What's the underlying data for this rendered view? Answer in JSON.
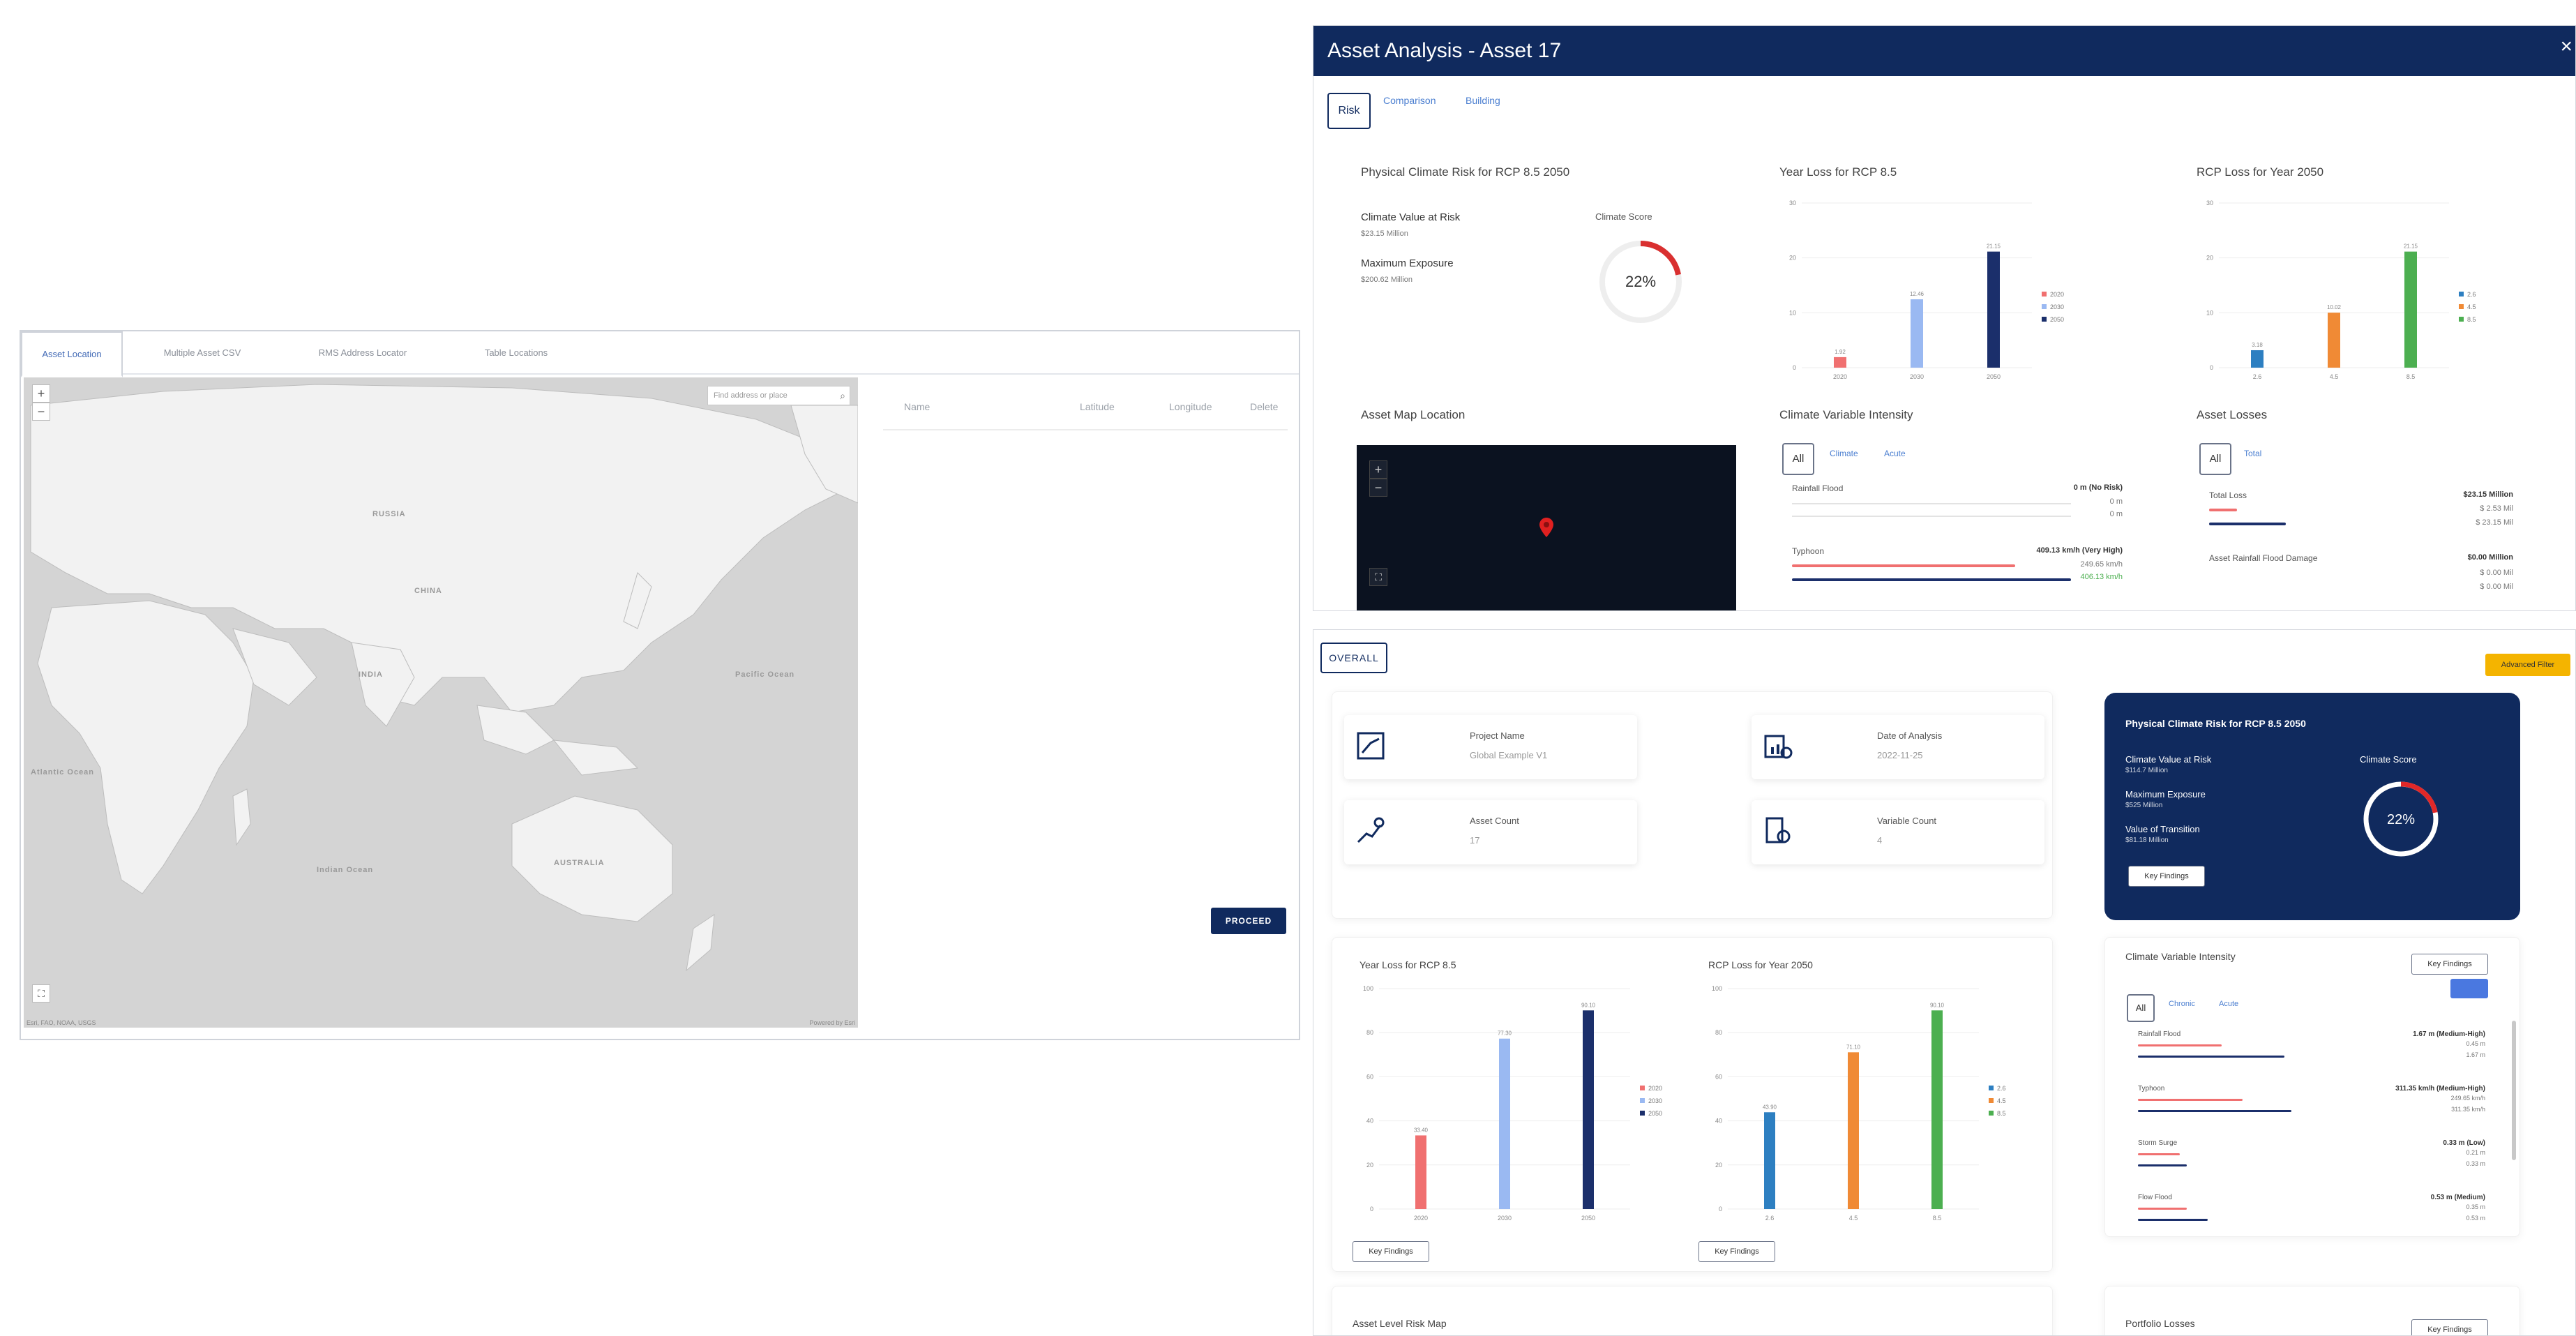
{
  "asset_location": {
    "tabs": [
      "Asset Location",
      "Multiple Asset CSV",
      "RMS Address Locator",
      "Table Locations"
    ],
    "map": {
      "search_placeholder": "Find address or place",
      "zoom_in": "+",
      "zoom_out": "−",
      "fullscreen": "⛶",
      "attribution_left": "Esri, FAO, NOAA, USGS",
      "attribution_right": "Powered by Esri",
      "labels": [
        "RUSSIA",
        "CHINA",
        "INDIA",
        "AUSTRALIA",
        "Pacific Ocean",
        "Indian Ocean",
        "Atlantic Ocean"
      ]
    },
    "table_headers": [
      "Name",
      "Latitude",
      "Longitude",
      "Delete"
    ],
    "proceed_label": "PROCEED"
  },
  "asset_analysis": {
    "title": "Asset Analysis - Asset 17",
    "close_label": "×",
    "tabs": {
      "active": "Risk",
      "others": [
        "Comparison",
        "Building"
      ]
    },
    "physical_risk": {
      "title": "Physical Climate Risk for RCP 8.5 2050",
      "cvar_label": "Climate Value at Risk",
      "cvar_value": "$23.15 Million",
      "max_exposure_label": "Maximum Exposure",
      "max_exposure_value": "$200.62 Million",
      "score_label": "Climate Score",
      "score_value": "22%",
      "score_fraction": 0.22
    },
    "year_loss_title": "Year Loss for RCP 8.5",
    "rcp_loss_title": "RCP Loss for Year 2050",
    "asset_map_title": "Asset Map Location",
    "climate_intensity": {
      "title": "Climate Variable Intensity",
      "all": "All",
      "links": [
        "Climate",
        "Acute"
      ],
      "rows": [
        {
          "label": "Rainfall Flood",
          "value": "0 m (No Risk)",
          "sub1": "0 m",
          "sub2": "0 m"
        },
        {
          "label": "Typhoon",
          "value": "409.13 km/h (Very High)",
          "sub1": "249.65 km/h",
          "sub2": "406.13 km/h"
        }
      ]
    },
    "asset_losses": {
      "title": "Asset Losses",
      "all": "All",
      "links": [
        "Total"
      ],
      "rows": [
        {
          "label": "Total Loss",
          "value": "$23.15 Million",
          "sub1": "$ 2.53 Mil",
          "sub2": "$ 23.15 Mil"
        },
        {
          "label": "Asset Rainfall Flood Damage",
          "value": "$0.00 Million",
          "sub1": "$ 0.00 Mil",
          "sub2": "$ 0.00 Mil"
        }
      ]
    }
  },
  "overall": {
    "tab_label": "OVERALL",
    "filter_label": "Advanced Filter",
    "cards": [
      {
        "label": "Project Name",
        "value": "Global Example V1"
      },
      {
        "label": "Date of Analysis",
        "value": "2022-11-25"
      },
      {
        "label": "Asset Count",
        "value": "17"
      },
      {
        "label": "Variable Count",
        "value": "4"
      }
    ],
    "risk_card": {
      "title": "Physical Climate Risk for RCP 8.5 2050",
      "cvar_label": "Climate Value at Risk",
      "cvar_value": "$114.7 Million",
      "max_exposure_label": "Maximum Exposure",
      "max_exposure_value": "$525 Million",
      "vot_label": "Value of Transition",
      "vot_value": "$81.18 Million",
      "score_label": "Climate Score",
      "score_value": "22%",
      "score_fraction": 0.22,
      "key_findings": "Key Findings"
    },
    "year_loss_title": "Year Loss for RCP 8.5",
    "rcp_loss_title": "RCP Loss for Year 2050",
    "key_findings": "Key Findings",
    "climate_intensity": {
      "title": "Climate Variable Intensity",
      "key_findings": "Key Findings",
      "all": "All",
      "links": [
        "Chronic",
        "Acute"
      ],
      "rows": [
        {
          "label": "Rainfall Flood",
          "value": "1.67 m (Medium-High)",
          "sub1": "0.45 m",
          "sub2": "1.67 m"
        },
        {
          "label": "Typhoon",
          "value": "311.35 km/h (Medium-High)",
          "sub1": "249.65 km/h",
          "sub2": "311.35 km/h"
        },
        {
          "label": "Storm Surge",
          "value": "0.33 m (Low)",
          "sub1": "0.21 m",
          "sub2": "0.33 m"
        },
        {
          "label": "Flow Flood",
          "value": "0.53 m (Medium)",
          "sub1": "0.35 m",
          "sub2": "0.53 m"
        }
      ]
    },
    "asset_risk_map_title": "Asset Level Risk Map",
    "portfolio_losses_title": "Portfolio Losses",
    "portfolio_key_findings": "Key Findings"
  },
  "colors": {
    "navy": "#102a5e",
    "red": "#f07070",
    "light_blue": "#9ab9f2",
    "dark_navy": "#1b2f6b",
    "blue": "#2d7fc1",
    "orange": "#f08a35",
    "green": "#4caf50",
    "amber": "#f4b400"
  },
  "chart_data": [
    {
      "id": "aa_year_loss",
      "type": "bar",
      "title": "Year Loss for RCP 8.5",
      "categories": [
        "2020",
        "2030",
        "2050"
      ],
      "values": [
        1.92,
        12.46,
        21.15
      ],
      "data_labels": [
        "1.92",
        "12.46",
        "21.15"
      ],
      "legend": [
        "2020",
        "2030",
        "2050"
      ],
      "ylim": [
        0,
        30
      ],
      "yticks": [
        0,
        10,
        20,
        30
      ]
    },
    {
      "id": "aa_rcp_loss",
      "type": "bar",
      "title": "RCP Loss for Year 2050",
      "categories": [
        "2.6",
        "4.5",
        "8.5"
      ],
      "values": [
        3.18,
        10.02,
        21.15
      ],
      "data_labels": [
        "3.18",
        "10.02",
        "21.15"
      ],
      "legend": [
        "2.6",
        "4.5",
        "8.5"
      ],
      "ylim": [
        0,
        30
      ],
      "yticks": [
        0,
        10,
        20,
        30
      ]
    },
    {
      "id": "ov_year_loss",
      "type": "bar",
      "title": "Year Loss for RCP 8.5",
      "categories": [
        "2020",
        "2030",
        "2050"
      ],
      "values": [
        33.4,
        77.3,
        90.1
      ],
      "data_labels": [
        "33.40",
        "77.30",
        "90.10"
      ],
      "legend": [
        "2020",
        "2030",
        "2050"
      ],
      "ylim": [
        0,
        100
      ],
      "yticks": [
        0,
        20,
        40,
        60,
        80,
        100
      ]
    },
    {
      "id": "ov_rcp_loss",
      "type": "bar",
      "title": "RCP Loss for Year 2050",
      "categories": [
        "2.6",
        "4.5",
        "8.5"
      ],
      "values": [
        43.9,
        71.1,
        90.1
      ],
      "data_labels": [
        "43.90",
        "71.10",
        "90.10"
      ],
      "legend": [
        "2.6",
        "4.5",
        "8.5"
      ],
      "ylim": [
        0,
        100
      ],
      "yticks": [
        0,
        20,
        40,
        60,
        80,
        100
      ]
    }
  ]
}
